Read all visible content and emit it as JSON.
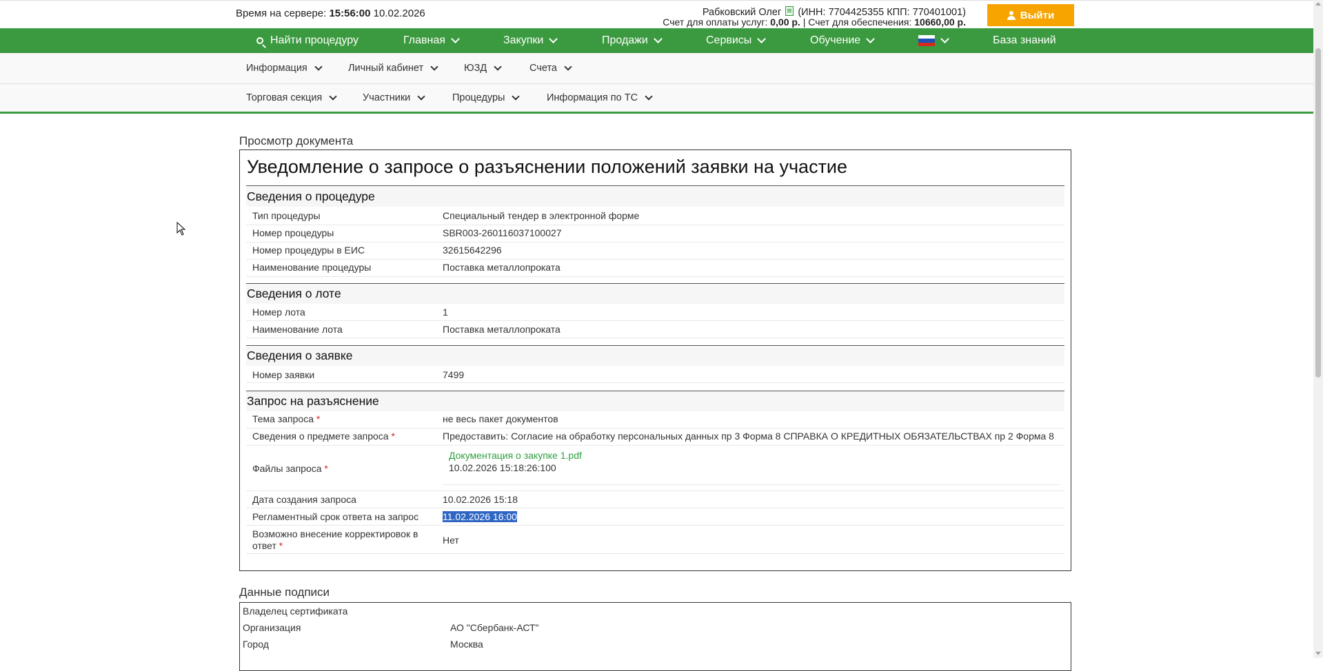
{
  "header": {
    "server_time_label": "Время на сервере:",
    "server_time": "15:56:00",
    "server_date": "10.02.2026",
    "user_name": "Рабковский Олег",
    "user_ids": "(ИНН: 7704425355 КПП: 770401001)",
    "account_services_label": "Счет для оплаты услуг:",
    "account_services_value": "0,00 р.",
    "account_sep": "|",
    "account_security_label": "Счет для обеспечения:",
    "account_security_value": "10660,00 р.",
    "logout_label": "Выйти"
  },
  "main_nav": {
    "search_label": "Найти процедуру",
    "items": [
      "Главная",
      "Закупки",
      "Продажи",
      "Сервисы",
      "Обучение"
    ],
    "knowledge_base": "База знаний"
  },
  "sub_nav_1": [
    "Информация",
    "Личный кабинет",
    "ЮЗД",
    "Счета"
  ],
  "sub_nav_2": [
    "Торговая секция",
    "Участники",
    "Процедуры",
    "Информация по ТС"
  ],
  "document": {
    "caption": "Просмотр документа",
    "title": "Уведомление о запросе о разъяснении положений заявки на участие",
    "procedure": {
      "heading": "Сведения о процедуре",
      "rows": [
        {
          "label": "Тип процедуры",
          "value": "Специальный тендер в электронной форме"
        },
        {
          "label": "Номер процедуры",
          "value": "SBR003-260116037100027"
        },
        {
          "label": "Номер процедуры в ЕИС",
          "value": "32615642296"
        },
        {
          "label": "Наименование процедуры",
          "value": "Поставка металлопроката"
        }
      ]
    },
    "lot": {
      "heading": "Сведения о лоте",
      "rows": [
        {
          "label": "Номер лота",
          "value": "1"
        },
        {
          "label": "Наименование лота",
          "value": "Поставка металлопроката"
        }
      ]
    },
    "application": {
      "heading": "Сведения о заявке",
      "rows": [
        {
          "label": "Номер заявки",
          "value": "7499"
        }
      ]
    },
    "request": {
      "heading": "Запрос на разъяснение",
      "required_mark": "*",
      "topic_label": "Тема запроса",
      "topic_value": "не весь пакет документов",
      "subject_label": "Сведения о предмете запроса",
      "subject_value": "Предоставить: Согласие на обработку персональных данных пр 3 Форма 8 СПРАВКА О КРЕДИТНЫХ ОБЯЗАТЕЛЬСТВАХ пр 2 Форма 8",
      "files_label": "Файлы запроса",
      "file_name": "Документация о закупке 1.pdf",
      "file_date": "10.02.2026 15:18:26:100",
      "created_label": "Дата создания запроса",
      "created_value": "10.02.2026 15:18",
      "deadline_label": "Регламентный срок ответа на запрос",
      "deadline_value": "11.02.2026 16:00",
      "corrections_label_1": "Возможно внесение корректировок в",
      "corrections_label_2": "ответ",
      "corrections_value": "Нет"
    }
  },
  "signature": {
    "caption": "Данные подписи",
    "owner_label": "Владелец сертификата",
    "org_label": "Организация",
    "org_value": "АО \"Сбербанк-АСТ\"",
    "city_label": "Город",
    "city_value": "Москва"
  },
  "colors": {
    "brand_green": "#3b9a3f",
    "logout_orange": "#f7a400",
    "link_green": "#2e9e3e",
    "required_red": "#d9241c",
    "selection_blue": "#2f66c4"
  }
}
